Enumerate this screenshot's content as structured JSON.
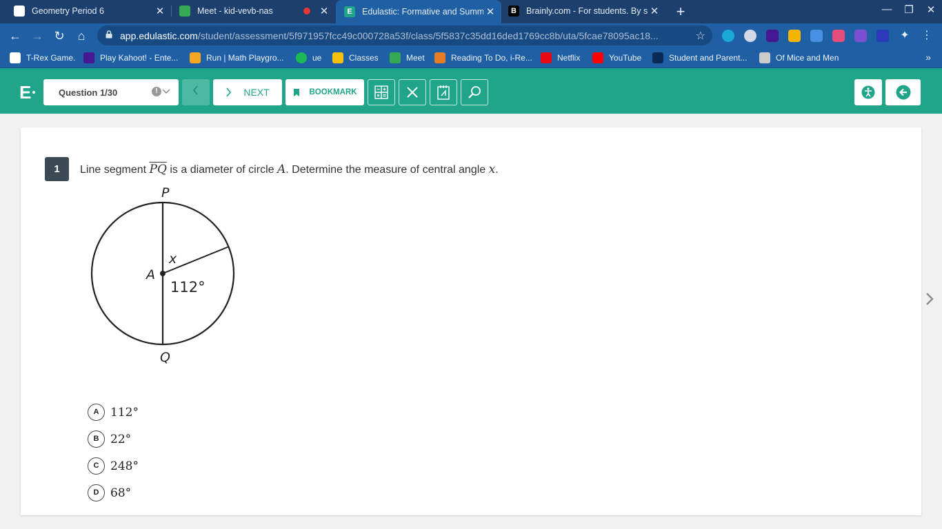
{
  "browser": {
    "tabs": [
      {
        "title": "Geometry Period 6",
        "favicon_color": "#ffffff",
        "active": false
      },
      {
        "title": "Meet - kid-vevb-nas",
        "favicon_color": "#34a853",
        "active": false,
        "recording": true
      },
      {
        "title": "Edulastic: Formative and Summ",
        "favicon_color": "#21a58a",
        "active": true
      },
      {
        "title": "Brainly.com - For students. By st",
        "favicon_color": "#000000",
        "active": false
      }
    ],
    "url_domain": "app.edulastic.com",
    "url_path": "/student/assessment/5f971957fcc49c000728a53f/class/5f5837c35dd16ded1769cc8b/uta/5fcae78095ac18...",
    "bookmarks": [
      {
        "label": "T-Rex Game.",
        "color": "#ffffff"
      },
      {
        "label": "Play Kahoot! - Ente...",
        "color": "#46178f"
      },
      {
        "label": "Run | Math Playgro...",
        "color": "#f5a623"
      },
      {
        "label": "ue",
        "color": "#1db954"
      },
      {
        "label": "Classes",
        "color": "#f4c20d"
      },
      {
        "label": "Meet",
        "color": "#34a853"
      },
      {
        "label": "Reading To Do, i-Re...",
        "color": "#e57c23"
      },
      {
        "label": "Netflix",
        "color": "#e50914"
      },
      {
        "label": "YouTube",
        "color": "#ff0000"
      },
      {
        "label": "Student and Parent...",
        "color": "#0b2b57"
      },
      {
        "label": "Of Mice and Men",
        "color": "#cccccc"
      }
    ]
  },
  "header": {
    "question_selector": "Question 1/30",
    "next_label": "NEXT",
    "bookmark_label": "BOOKMARK",
    "accent": "#21a58a"
  },
  "question": {
    "number": "1",
    "text_1": "Line segment ",
    "segment": "PQ",
    "text_2": " is a diameter of circle ",
    "circle": "A",
    "text_3": ". Determine the measure of central angle ",
    "angle_var": "x",
    "text_4": ".",
    "diagram": {
      "label_p": "P",
      "label_q": "Q",
      "label_a": "A",
      "label_x": "x",
      "label_angle": "112°"
    },
    "choices": [
      {
        "letter": "A",
        "value": "112°"
      },
      {
        "letter": "B",
        "value": "22°"
      },
      {
        "letter": "C",
        "value": "248°"
      },
      {
        "letter": "D",
        "value": "68°"
      }
    ]
  }
}
